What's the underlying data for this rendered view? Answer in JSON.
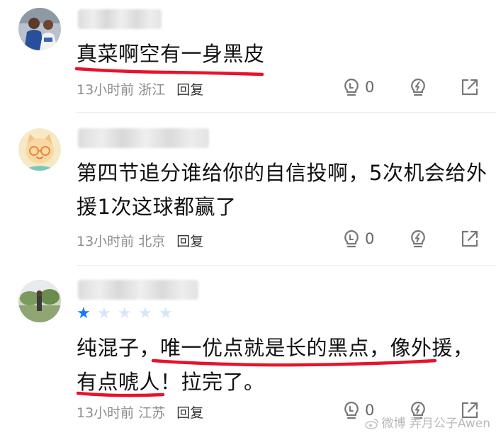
{
  "comments": [
    {
      "avatar_icon": "basketball-player-photo",
      "text_lines": [
        "真菜啊空有一身黑皮"
      ],
      "time": "13小时前",
      "location": "浙江",
      "reply_label": "回复",
      "like_count": "0"
    },
    {
      "avatar_icon": "cartoon-cat-with-glasses",
      "text_lines": [
        "第四节追分谁给你的自信投啊，5次机会给外",
        "援1次这球都赢了"
      ],
      "time": "13小时前",
      "location": "北京",
      "reply_label": "回复",
      "like_count": "0"
    },
    {
      "avatar_icon": "outdoor-photo",
      "rating": 1,
      "rating_max": 5,
      "text_lines": [
        "纯混子，唯一优点就是长的黑点，像外援，",
        "有点唬人！拉完了。"
      ],
      "time": "13小时前",
      "location": "江苏",
      "reply_label": "回复",
      "like_count": "0"
    }
  ],
  "icons": {
    "like": "lightbulb-like-icon",
    "dislike": "lightning-bulb-icon",
    "share": "share-arrow-icon"
  },
  "watermark": "微博 弄月公子Awen",
  "colors": {
    "underline": "#e8122a",
    "star_filled": "#1677ff",
    "star_empty": "#d6e6fb",
    "meta_text": "#8c8c8c"
  }
}
